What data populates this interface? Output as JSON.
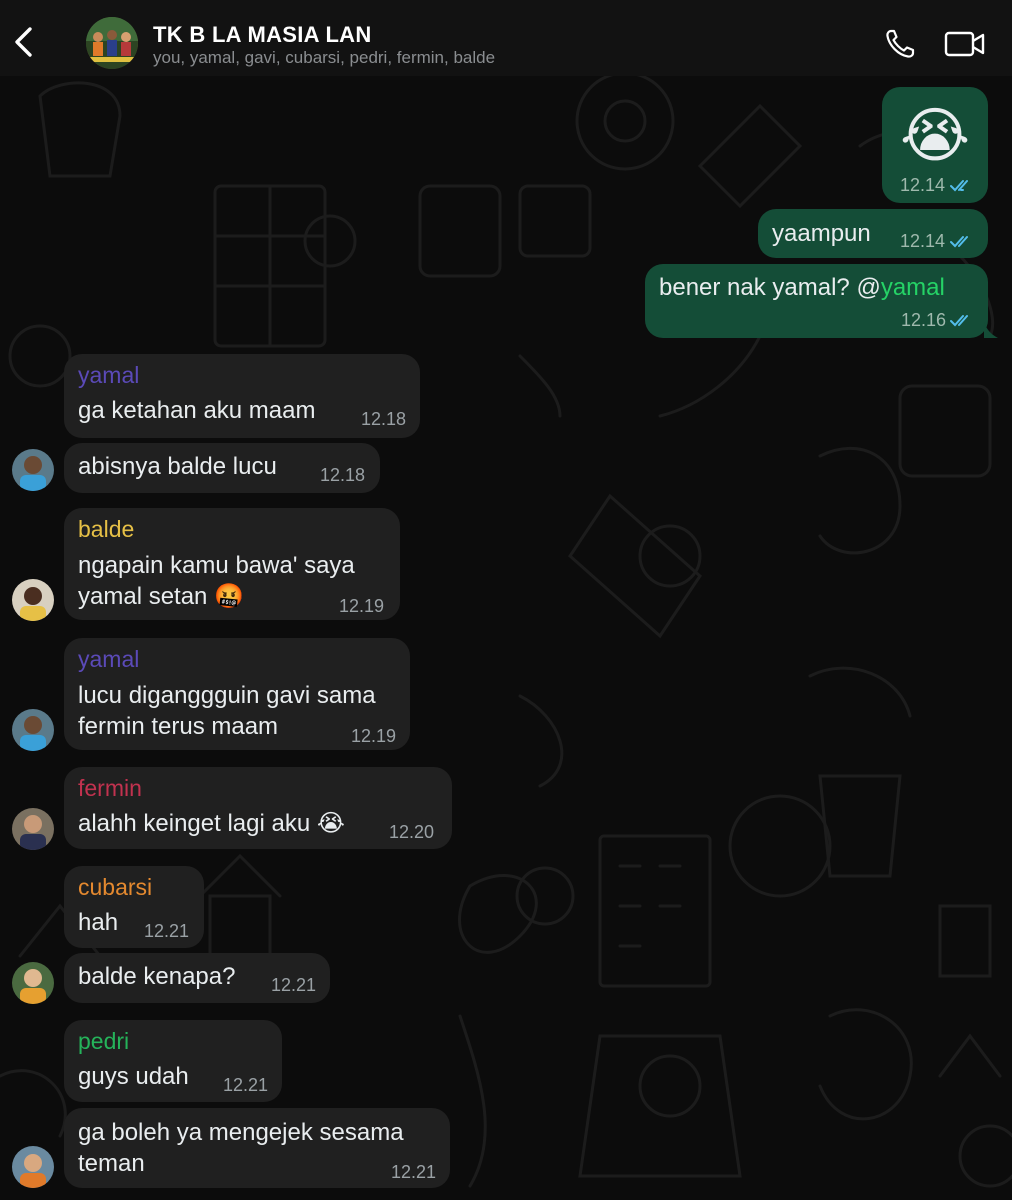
{
  "header": {
    "back_icon": "chevron-left-icon",
    "title": "TK B LA MASIA LAN",
    "members": "you, yamal, gavi, cubarsi, pedri, fermin, balde",
    "call_icon": "phone-icon",
    "video_icon": "video-camera-icon"
  },
  "colors": {
    "outgoing_bubble": "#144d37",
    "incoming_bubble": "#202020",
    "read_ticks": "#53bdeb",
    "yamal": "#5b4ab8",
    "balde": "#e6c046",
    "fermin": "#c2324f",
    "cubarsi": "#e4892f",
    "pedri": "#25b35a"
  },
  "messages": [
    {
      "id": "m1",
      "direction": "out",
      "text": "😭",
      "time": "12.14",
      "status": "read"
    },
    {
      "id": "m2",
      "direction": "out",
      "text": "yaampun",
      "time": "12.14",
      "status": "read"
    },
    {
      "id": "m3",
      "direction": "out",
      "text": "bener nak yamal? @",
      "mention": "yamal",
      "time": "12.16",
      "status": "read"
    },
    {
      "id": "m4",
      "direction": "in",
      "sender": "yamal",
      "text": "ga ketahan aku maam",
      "time": "12.18"
    },
    {
      "id": "m5",
      "direction": "in",
      "text": "abisnya balde lucu",
      "time": "12.18"
    },
    {
      "id": "m6",
      "direction": "in",
      "sender": "balde",
      "lines": [
        "ngapain kamu bawa' saya",
        "yamal setan 🤬"
      ],
      "time": "12.19"
    },
    {
      "id": "m7",
      "direction": "in",
      "sender": "yamal",
      "lines": [
        "lucu diganggguin gavi sama",
        "fermin terus maam"
      ],
      "time": "12.19"
    },
    {
      "id": "m8",
      "direction": "in",
      "sender": "fermin",
      "text": "alahh keinget lagi aku 😭",
      "time": "12.20"
    },
    {
      "id": "m9",
      "direction": "in",
      "sender": "cubarsi",
      "text": "hah",
      "time": "12.21"
    },
    {
      "id": "m10",
      "direction": "in",
      "text": "balde kenapa?",
      "time": "12.21"
    },
    {
      "id": "m11",
      "direction": "in",
      "sender": "pedri",
      "text": "guys udah",
      "time": "12.21"
    },
    {
      "id": "m12",
      "direction": "in",
      "lines": [
        "ga boleh ya mengejek sesama",
        "teman"
      ],
      "time": "12.21"
    }
  ]
}
